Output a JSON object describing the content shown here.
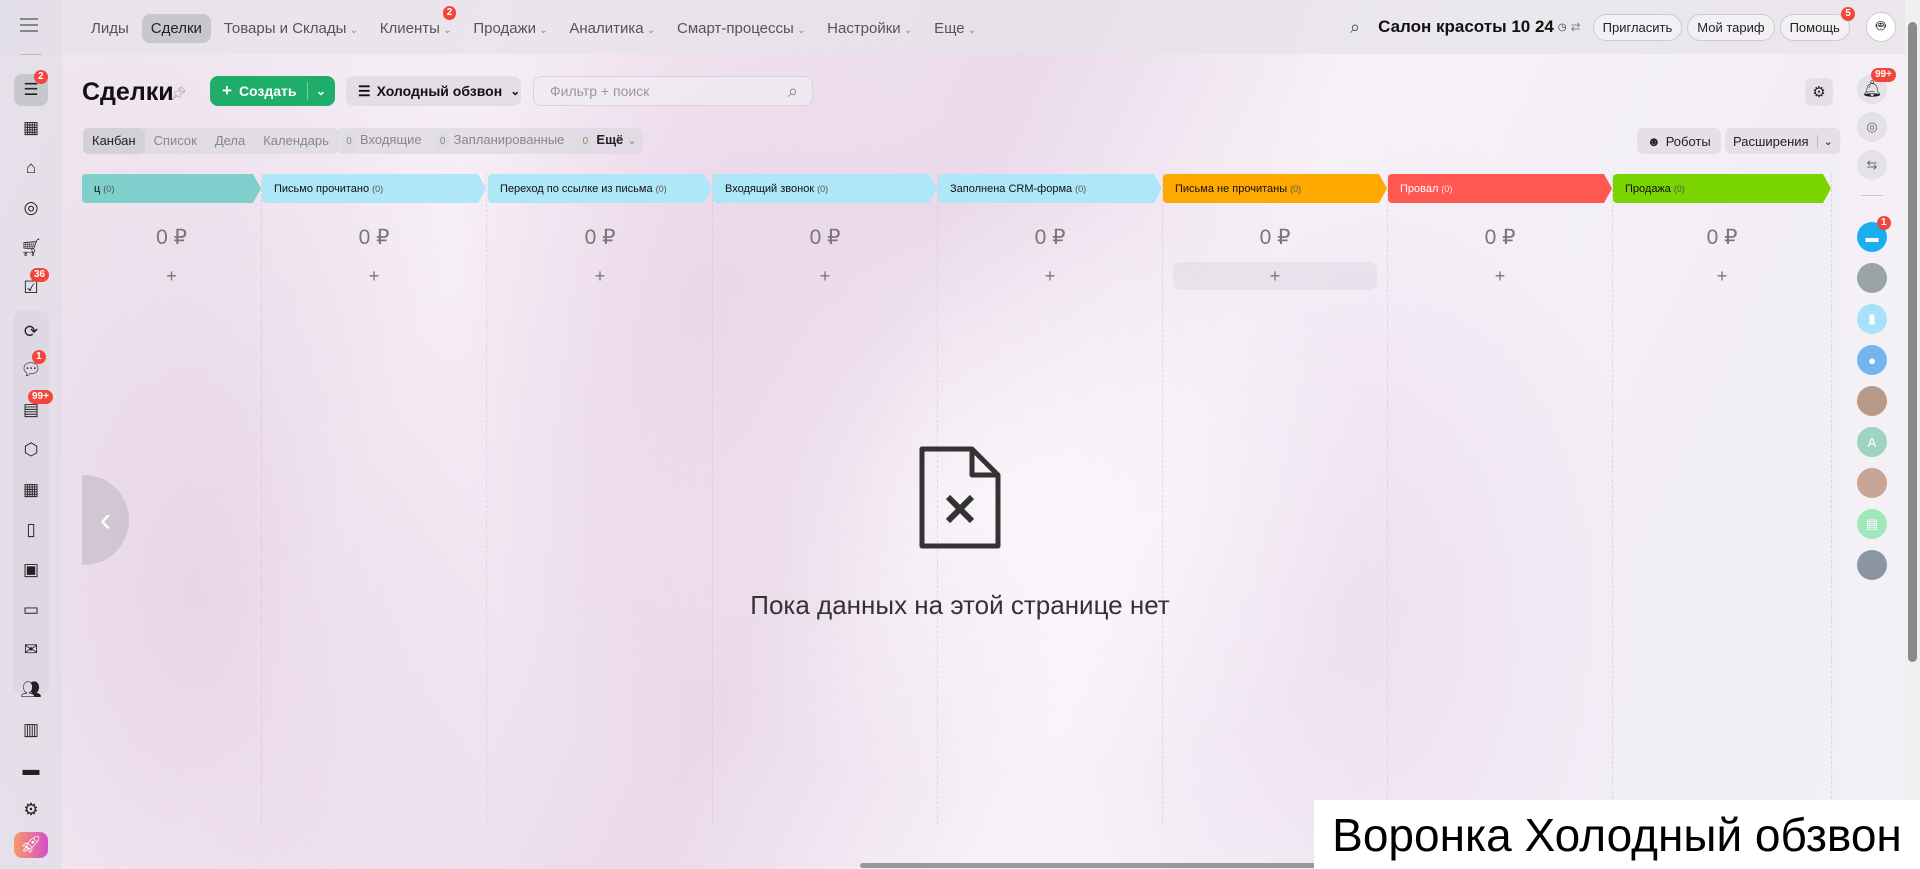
{
  "nav": {
    "items": [
      {
        "label": "Лиды"
      },
      {
        "label": "Сделки",
        "active": true
      },
      {
        "label": "Товары и Склады",
        "chevron": true
      },
      {
        "label": "Клиенты",
        "chevron": true,
        "badge": "2"
      },
      {
        "label": "Продажи",
        "chevron": true
      },
      {
        "label": "Аналитика",
        "chevron": true
      },
      {
        "label": "Смарт-процессы",
        "chevron": true
      },
      {
        "label": "Настройки",
        "chevron": true
      },
      {
        "label": "Еще",
        "chevron": true
      }
    ]
  },
  "header": {
    "company": "Салон красоты 10 24",
    "invite": "Пригласить",
    "tariff": "Мой тариф",
    "help": "Помощь",
    "help_badge": "5"
  },
  "left_sidebar": {
    "badges": {
      "deals": "2",
      "tasks": "36",
      "chats": "1",
      "feed": "99+"
    }
  },
  "page": {
    "title": "Сделки",
    "create": "Создать",
    "funnel": "Холодный обзвон",
    "search_placeholder": "Фильтр + поиск",
    "views": [
      "Канбан",
      "Список",
      "Дела",
      "Календарь"
    ],
    "counters": [
      {
        "count": "0",
        "label": "Входящие"
      },
      {
        "count": "0",
        "label": "Запланированные"
      },
      {
        "count": "0",
        "label": "Ещё"
      }
    ],
    "robots": "Роботы",
    "extensions": "Расширения"
  },
  "kanban": {
    "columns": [
      {
        "name": "ц",
        "count": "(0)",
        "sum": "0 ₽",
        "color": "#7fd0cc"
      },
      {
        "name": "Письмо прочитано",
        "count": "(0)",
        "sum": "0 ₽",
        "color": "#ade7f8"
      },
      {
        "name": "Переход по ссылке из письма",
        "count": "(0)",
        "sum": "0 ₽",
        "color": "#ade7f8"
      },
      {
        "name": "Входящий звонок",
        "count": "(0)",
        "sum": "0 ₽",
        "color": "#ade7f8"
      },
      {
        "name": "Заполнена CRM-форма",
        "count": "(0)",
        "sum": "0 ₽",
        "color": "#ade7f8"
      },
      {
        "name": "Письма не прочитаны",
        "count": "(0)",
        "sum": "0 ₽",
        "color": "#ffa900"
      },
      {
        "name": "Провал",
        "count": "(0)",
        "sum": "0 ₽",
        "color": "#ff5752"
      },
      {
        "name": "Продажа",
        "count": "(0)",
        "sum": "0 ₽",
        "color": "#7bd500"
      }
    ],
    "add": "+",
    "empty_text": "Пока данных на этой странице нет"
  },
  "right_sidebar": {
    "notif_badge": "99+",
    "chat_badge": "1",
    "avatar_letter": "A"
  },
  "caption": "Воронка Холодный обзвон"
}
